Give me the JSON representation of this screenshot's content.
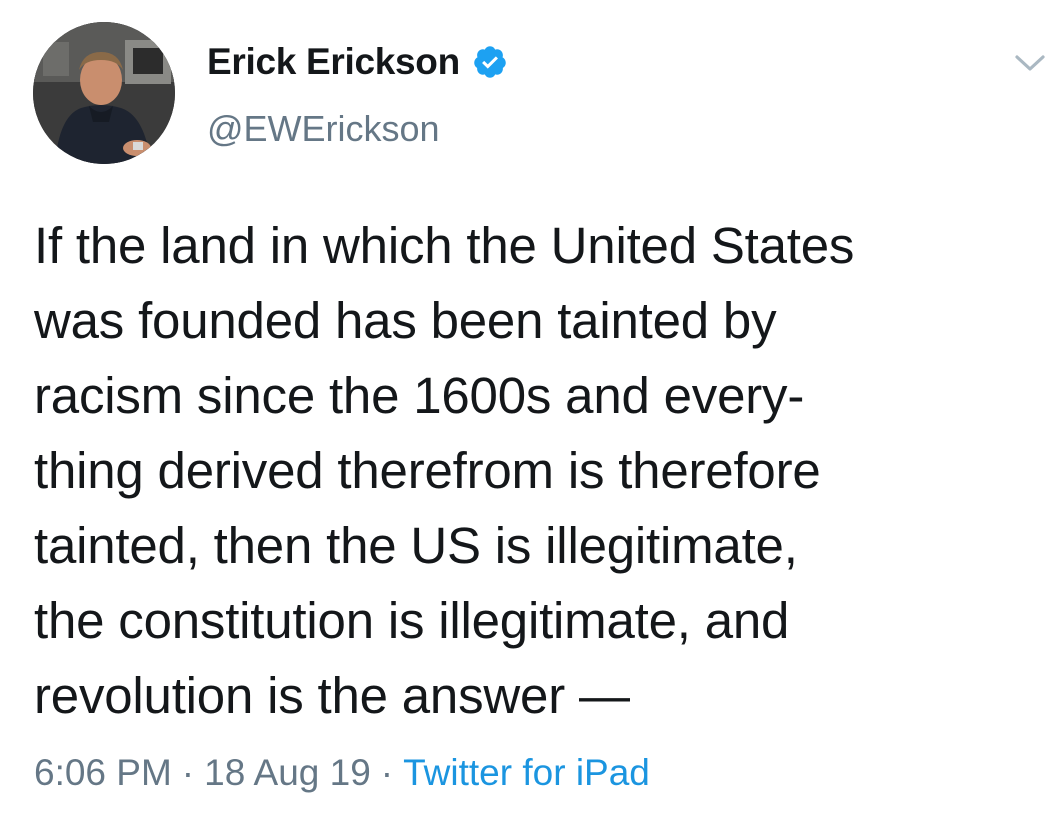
{
  "author": {
    "display_name": "Erick Erickson",
    "handle": "@EWErickson",
    "verified_icon": "verified-badge-icon",
    "badge_color": "#1da1f2"
  },
  "menu": {
    "icon": "chevron-down-icon"
  },
  "tweet": {
    "lines": [
      "If the land in which the United States",
      "was founded has been tainted by",
      "racism since the 1600s and every-",
      "thing derived therefrom is therefore",
      "tainted, then the US is illegitimate,",
      "the constitution is illegitimate, and",
      "revolution is the answer —"
    ]
  },
  "meta": {
    "time": "6:06 PM",
    "separator": "·",
    "date": "18 Aug 19",
    "source": "Twitter for iPad",
    "source_color": "#1b95e0"
  }
}
